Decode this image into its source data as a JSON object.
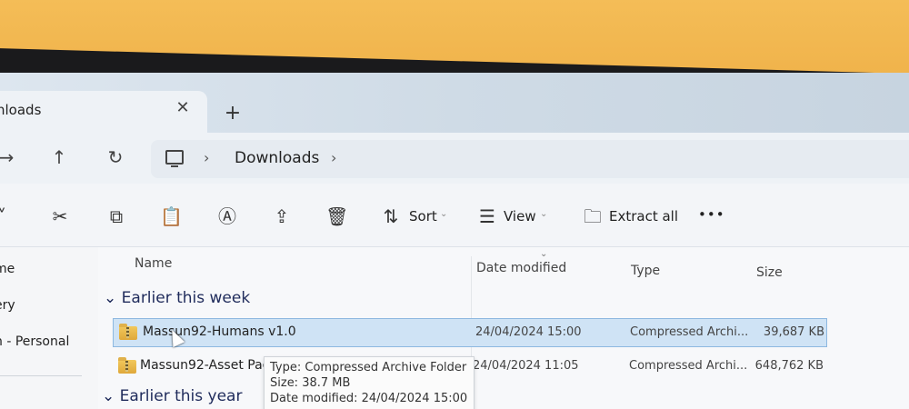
{
  "window": {
    "tab_title": "nloads",
    "close_tab_glyph": "✕",
    "new_tab_glyph": "+"
  },
  "navigation": {
    "forward_glyph": "→",
    "up_glyph": "↑",
    "refresh_glyph": "↻",
    "breadcrumb_sep": "›",
    "breadcrumb_current": "Downloads",
    "breadcrumb_end": "›"
  },
  "toolbar": {
    "more_glyph": "˅",
    "cut_glyph": "✂",
    "copy_glyph": "⧉",
    "paste_glyph": "📋",
    "rename_glyph": "Ⓐ",
    "share_glyph": "⇪",
    "delete_glyph": "🗑",
    "sort_label": "Sort",
    "sort_glyph": "⇅",
    "view_label": "View",
    "view_glyph": "☰",
    "extract_label": "Extract all",
    "extract_glyph": "🗀",
    "overflow_glyph": "•••",
    "caret_glyph": "⌄"
  },
  "sidebar": {
    "items": [
      "me",
      "ery",
      "n - Personal"
    ]
  },
  "columns": {
    "name": "Name",
    "date": "Date modified",
    "type": "Type",
    "size": "Size",
    "sort_indicator": "⌄"
  },
  "groups": {
    "earlier_week": "Earlier this week",
    "earlier_year": "Earlier this year",
    "chevron": "⌄"
  },
  "files": [
    {
      "name": "Massun92-Humans v1.0",
      "date": "24/04/2024 15:00",
      "type": "Compressed Archi...",
      "size": "39,687 KB"
    },
    {
      "name": "Massun92-Asset Pac",
      "date": "24/04/2024 11:05",
      "type": "Compressed Archi...",
      "size": "648,762 KB"
    }
  ],
  "tooltip": {
    "type_line": "Type: Compressed Archive Folder",
    "size_line": "Size: 38.7 MB",
    "date_line": "Date modified: 24/04/2024 15:00"
  },
  "colors": {
    "selection": "#cfe3f5",
    "selection_border": "#8db8e0",
    "group_text": "#1f2b5b",
    "wall": "#f2b54c"
  }
}
